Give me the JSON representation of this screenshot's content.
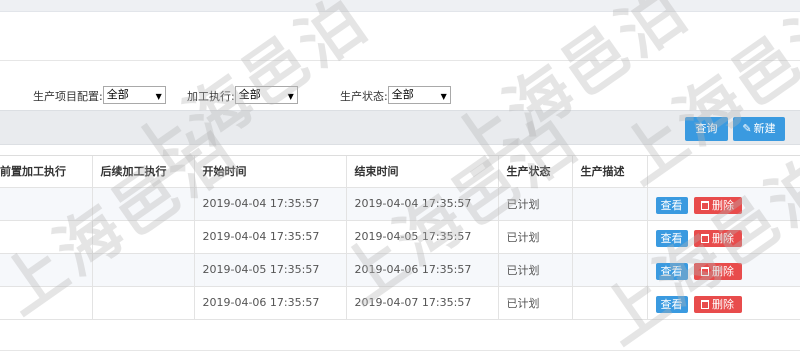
{
  "filters": {
    "project_config": {
      "label": "生产项目配置:",
      "value": "全部"
    },
    "process_exec": {
      "label": "加工执行:",
      "value": "全部"
    },
    "status": {
      "label": "生产状态:",
      "value": "全部"
    }
  },
  "toolbar": {
    "query_label": "查询",
    "new_label": "新建"
  },
  "table": {
    "columns": [
      "前置加工执行",
      "后续加工执行",
      "开始时间",
      "结束时间",
      "生产状态",
      "生产描述",
      ""
    ],
    "rows": [
      {
        "prev": "",
        "next": "",
        "start": "2019-04-04 17:35:57",
        "end": "2019-04-04 17:35:57",
        "status": "已计划",
        "desc": ""
      },
      {
        "prev": "",
        "next": "",
        "start": "2019-04-04 17:35:57",
        "end": "2019-04-05 17:35:57",
        "status": "已计划",
        "desc": ""
      },
      {
        "prev": "",
        "next": "",
        "start": "2019-04-05 17:35:57",
        "end": "2019-04-06 17:35:57",
        "status": "已计划",
        "desc": ""
      },
      {
        "prev": "",
        "next": "",
        "start": "2019-04-06 17:35:57",
        "end": "2019-04-07 17:35:57",
        "status": "已计划",
        "desc": ""
      }
    ],
    "view_label": "查看",
    "delete_label": "删除"
  },
  "watermark": "上海邑泊",
  "colors": {
    "primary": "#3a9ae0",
    "danger": "#e84c4c",
    "toolbar_bg": "#e9ebee"
  }
}
